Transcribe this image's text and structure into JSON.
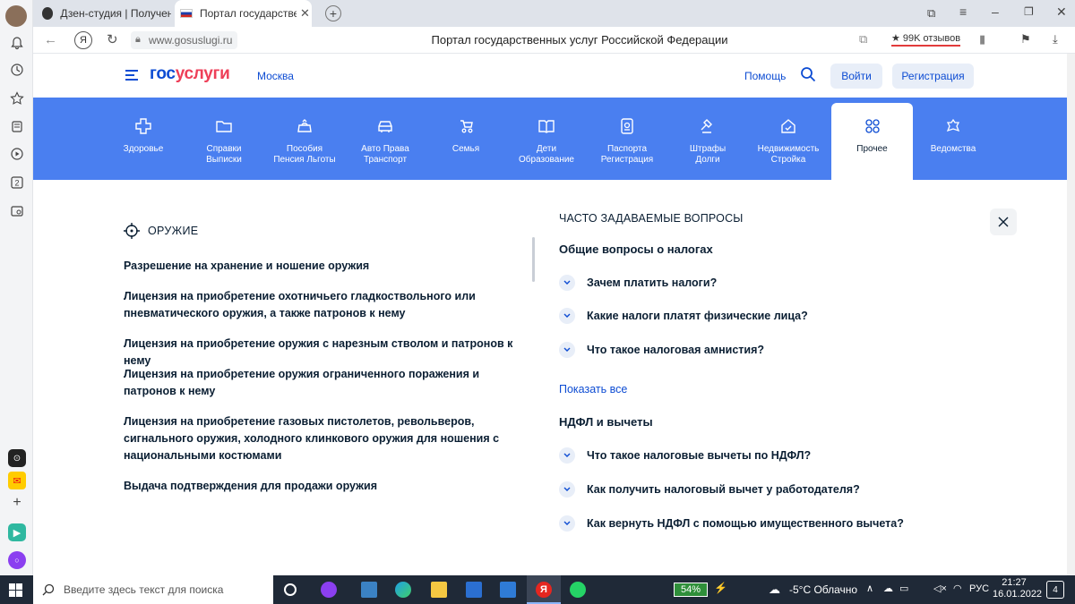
{
  "tabs": [
    {
      "title": "Дзен-студия | Получение"
    },
    {
      "title": "Портал государственных услуг"
    }
  ],
  "address": {
    "url": "www.gosuslugi.ru",
    "page_title": "Портал государственных услуг Российской Федерации",
    "reviews": "★ 99K отзывов"
  },
  "header": {
    "logo_left": "гос",
    "logo_right": "услуги",
    "city": "Москва",
    "help": "Помощь",
    "login": "Войти",
    "register": "Регистрация"
  },
  "categories": [
    {
      "line1": "Здоровье",
      "line2": "",
      "icon": "plus-icon"
    },
    {
      "line1": "Справки",
      "line2": "Выписки",
      "icon": "folder-icon"
    },
    {
      "line1": "Пособия",
      "line2": "Пенсия Льготы",
      "icon": "wallet-icon"
    },
    {
      "line1": "Авто Права",
      "line2": "Транспорт",
      "icon": "car-icon"
    },
    {
      "line1": "Семья",
      "line2": "",
      "icon": "stroller-icon"
    },
    {
      "line1": "Дети",
      "line2": "Образование",
      "icon": "book-icon"
    },
    {
      "line1": "Паспорта",
      "line2": "Регистрация",
      "icon": "passport-icon"
    },
    {
      "line1": "Штрафы",
      "line2": "Долги",
      "icon": "gavel-icon"
    },
    {
      "line1": "Недвижимость",
      "line2": "Стройка",
      "icon": "house-icon"
    },
    {
      "line1": "Прочее",
      "line2": "",
      "icon": "grid-icon"
    },
    {
      "line1": "Ведомства",
      "line2": "",
      "icon": "emblem-icon"
    }
  ],
  "section": {
    "title": "ОРУЖИЕ",
    "links": [
      "Разрешение на хранение и ношение оружия",
      "Лицензия на приобретение охотничьего гладкоствольного или пневматического оружия, а также патронов к нему",
      "Лицензия на приобретение оружия с нарезным стволом и патронов к нему",
      "Лицензия на приобретение оружия ограниченного поражения и патронов к нему",
      "Лицензия на приобретение газовых пистолетов, револьверов, сигнального оружия, холодного клинкового оружия для ношения с национальными костюмами",
      "Выдача подтверждения для продажи оружия"
    ]
  },
  "faq": {
    "title": "ЧАСТО ЗАДАВАЕМЫЕ ВОПРОСЫ",
    "group1": {
      "title": "Общие вопросы о налогах",
      "questions": [
        "Зачем платить налоги?",
        "Какие налоги платят физические лица?",
        "Что такое налоговая амнистия?"
      ]
    },
    "show_all": "Показать все",
    "group2": {
      "title": "НДФЛ и вычеты",
      "questions": [
        "Что такое налоговые вычеты по НДФЛ?",
        "Как получить налоговый вычет у работодателя?",
        "Как вернуть НДФЛ с помощью имущественного вычета?"
      ]
    }
  },
  "taskbar": {
    "search_placeholder": "Введите здесь текст для поиска",
    "battery": "54%",
    "weather": "-5°C  Облачно",
    "lang": "РУС",
    "time": "21:27",
    "date": "16.01.2022",
    "notifications": "4"
  },
  "colors": {
    "brand_blue": "#0d4cd3",
    "nav_blue": "#4a7ff0",
    "brand_red": "#ee3f58"
  }
}
